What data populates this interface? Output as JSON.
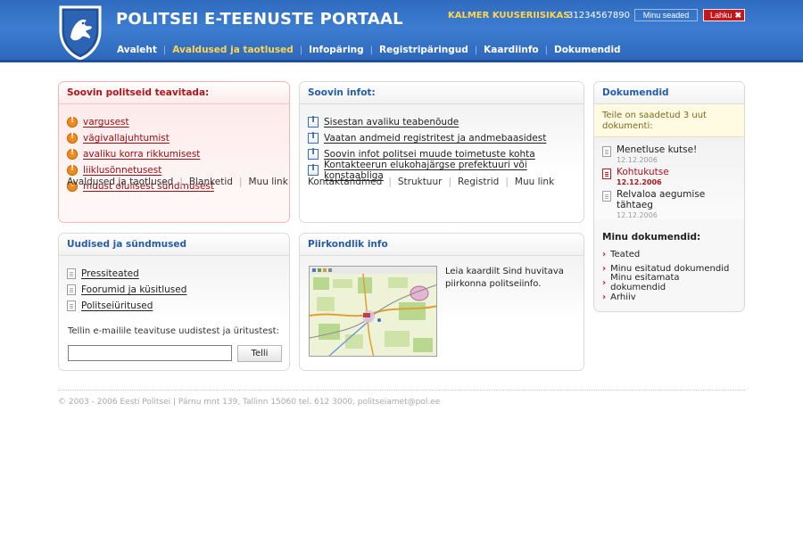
{
  "header": {
    "title": "POLITSEI E-TEENUSTE PORTAAL",
    "user_name": "KALMER KUUSERIISIKAS",
    "user_id": "31234567890",
    "settings_label": "Minu seaded",
    "logout_label": "Lahku",
    "nav": [
      {
        "label": "Avaleht",
        "active": false
      },
      {
        "label": "Avaldused ja taotlused",
        "active": true
      },
      {
        "label": "Infopäring",
        "active": false
      },
      {
        "label": "Registripäringud",
        "active": false
      },
      {
        "label": "Kaardiinfo",
        "active": false
      },
      {
        "label": "Dokumendid",
        "active": false
      }
    ]
  },
  "report_box": {
    "title": "Soovin politseid teavitada:",
    "items": [
      "vargusest",
      "vägivallajuhtumist",
      "avaliku korra rikkumisest",
      "liiklusõnnetusest",
      "muust olulisest sündmusest"
    ],
    "links": [
      "Avaldused ja taotlused",
      "Blanketid",
      "Muu link"
    ]
  },
  "info_box": {
    "title": "Soovin infot:",
    "items": [
      "Sisestan avaliku teabenõude",
      "Vaatan andmeid registritest ja andmebaasidest",
      "Soovin infot politsei muude toimetuste kohta",
      "Kontakteerun elukohajärgse prefektuuri või konstaabliga"
    ],
    "links": [
      "Kontaktandmed",
      "Struktuur",
      "Registrid",
      "Muu link"
    ]
  },
  "docs_box": {
    "title": "Dokumendid",
    "notice": "Teile on saadetud 3 uut dokumenti:",
    "items": [
      {
        "title": "Menetluse kutse!",
        "date": "12.12.2006",
        "unread": false
      },
      {
        "title": "Kohtukutse",
        "date": "12.12.2006",
        "unread": true
      },
      {
        "title": "Relvaloa aegumise tähtaeg",
        "date": "12.12.2006",
        "unread": false
      }
    ],
    "my_docs_title": "Minu dokumendid:",
    "my_docs": [
      "Teated",
      "Minu esitatud dokumendid",
      "Minu esitamata dokumendid",
      "Arhiiv"
    ]
  },
  "news_box": {
    "title": "Uudised ja sündmused",
    "items": [
      "Pressiteated",
      "Foorumid ja küsitlused",
      "Politseiüritused"
    ],
    "subscribe_label": "Tellin e-mailile teavituse uudistest ja üritustest:",
    "email_value": "",
    "subscribe_button": "Telli"
  },
  "map_box": {
    "title": "Piirkondlik info",
    "description": "Leia kaardilt Sind huvitava piirkonna politseiinfo."
  },
  "footer": {
    "text": "© 2003 - 2006 Eesti Politsei | Pärnu mnt 139, Tallinn 15060 tel. 612 3000, politseiamet@pol.ee"
  },
  "colors": {
    "header_blue": "#2f6bbf",
    "accent_yellow": "#ffd54a",
    "alert_red": "#b3131a",
    "link_blue": "#245cad"
  }
}
